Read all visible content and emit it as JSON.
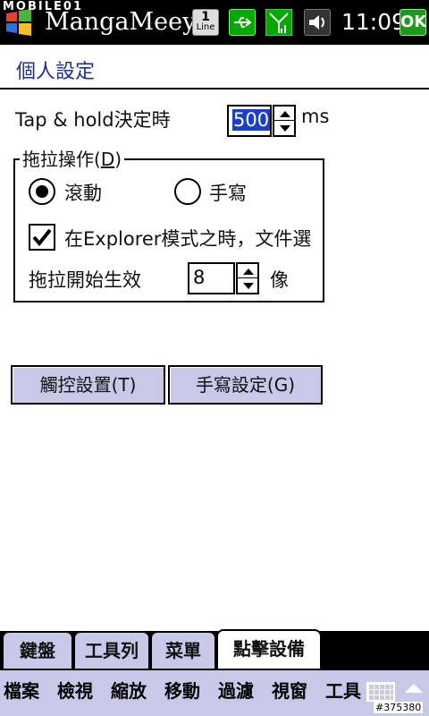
{
  "status_bar": {
    "watermark": "MOBILE01",
    "app_title": "MangaMeeya(",
    "line_icon": {
      "number": "1",
      "label": "Line"
    },
    "clock": "11:09",
    "ok_label": "OK",
    "icons": [
      "windows-start-icon",
      "line-notification-icon",
      "usb-icon",
      "signal-icon",
      "volume-icon"
    ]
  },
  "page": {
    "title": "個人設定"
  },
  "tap_hold": {
    "label": "Tap  &  hold決定時",
    "value": "500",
    "unit": "ms"
  },
  "drag_group": {
    "title": "拖拉操作(",
    "title_access": "D",
    "title_close": ")",
    "radio_scroll_label": "滾動",
    "radio_handwrite_label": "手寫",
    "selected": "scroll",
    "explorer_label": "在Explorer模式之時，文件選",
    "explorer_checked": true,
    "drag_start_label": "拖拉開始生效",
    "drag_start_value": "8",
    "drag_start_unit": "像"
  },
  "buttons": {
    "touch_label": "觸控設置(T)",
    "handwrite_label": "手寫設定(G)"
  },
  "tabs": [
    {
      "label": "鍵盤"
    },
    {
      "label": "工具列"
    },
    {
      "label": "菜單"
    },
    {
      "label": "點擊設備",
      "active": true
    }
  ],
  "menu": [
    {
      "label": "檔案"
    },
    {
      "label": "檢視"
    },
    {
      "label": "縮放"
    },
    {
      "label": "移動"
    },
    {
      "label": "過濾"
    },
    {
      "label": "視窗"
    },
    {
      "label": "工具"
    }
  ],
  "image_id": "#375380",
  "colors": {
    "title_blue": "#1d2f9c",
    "button_bg": "#c8c9e8",
    "selection_blue": "#1a3fd0",
    "ok_green": "#1d9a1d"
  }
}
